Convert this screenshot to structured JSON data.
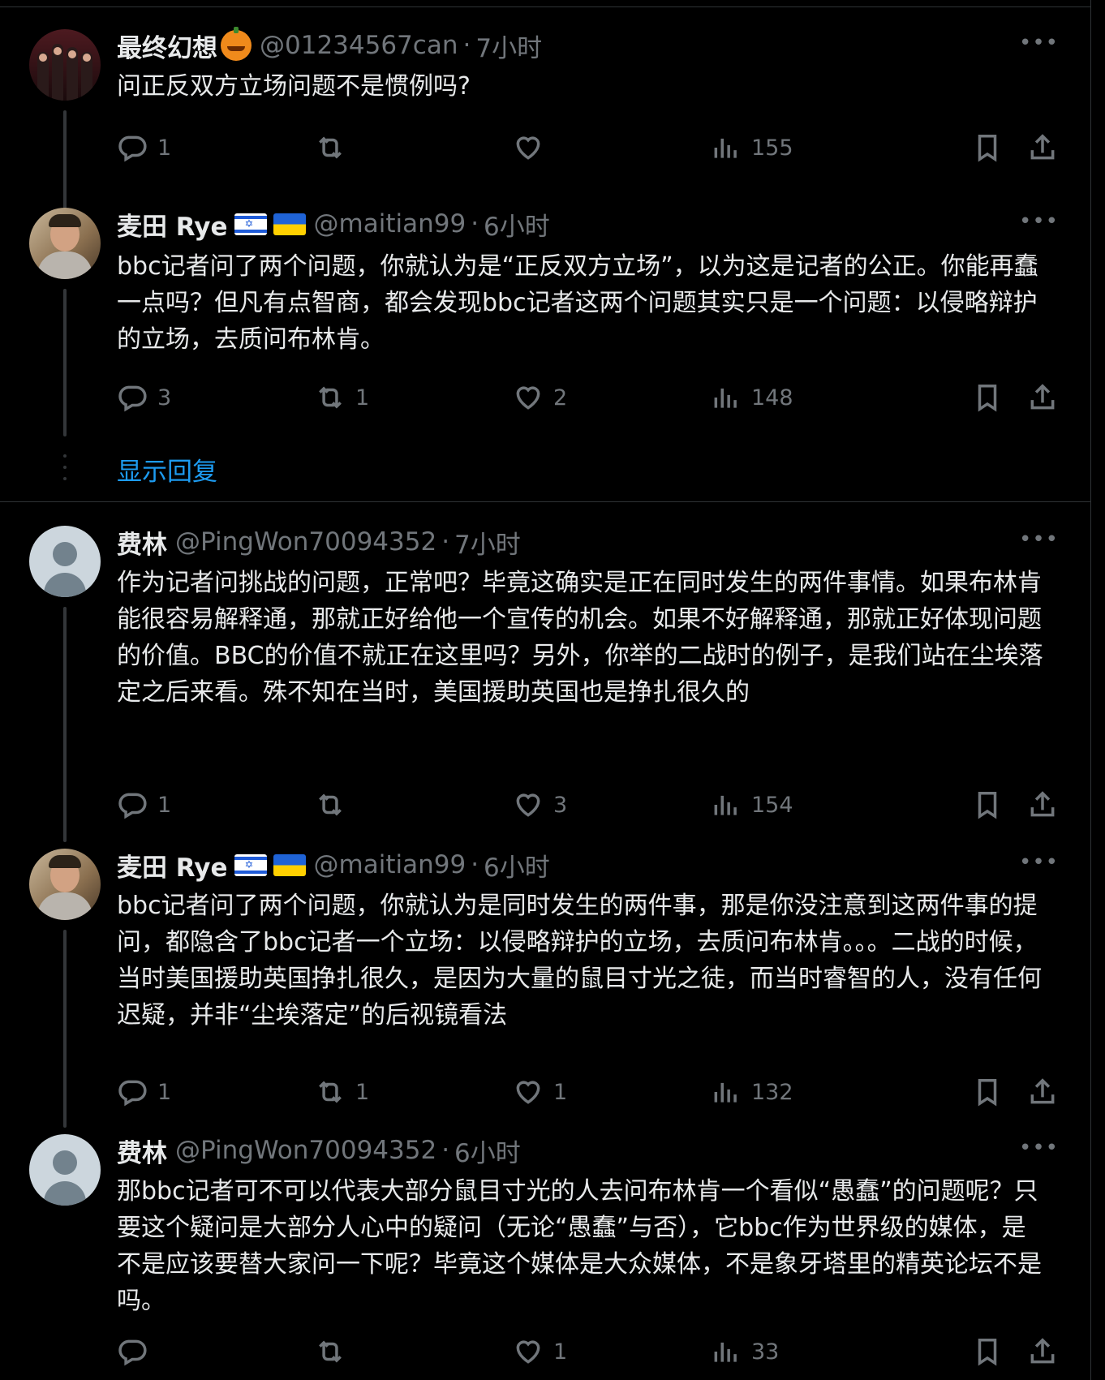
{
  "tweets": [
    {
      "name": "最终幻想",
      "handle": "@01234567can",
      "time": "7小时",
      "text": "问正反双方立场问题不是惯例吗?",
      "replies": "1",
      "retweets": "",
      "likes": "",
      "views": "155"
    },
    {
      "name": "麦田 Rye",
      "handle": "@maitian99",
      "time": "6小时",
      "text": "bbc记者问了两个问题，你就认为是“正反双方立场”，以为这是记者的公正。你能再蠢一点吗？但凡有点智商，都会发现bbc记者这两个问题其实只是一个问题：以侵略辩护的立场，去质问布林肯。",
      "replies": "3",
      "retweets": "1",
      "likes": "2",
      "views": "148"
    },
    {
      "name": "费林",
      "handle": "@PingWon70094352",
      "time": "7小时",
      "text": "作为记者问挑战的问题，正常吧？毕竟这确实是正在同时发生的两件事情。如果布林肯能很容易解释通，那就正好给他一个宣传的机会。如果不好解释通，那就正好体现问题的价值。BBC的价值不就正在这里吗？另外，你举的二战时的例子，是我们站在尘埃落定之后来看。殊不知在当时，美国援助英国也是挣扎很久的",
      "replies": "1",
      "retweets": "",
      "likes": "3",
      "views": "154"
    },
    {
      "name": "麦田 Rye",
      "handle": "@maitian99",
      "time": "6小时",
      "text": "bbc记者问了两个问题，你就认为是同时发生的两件事，那是你没注意到这两件事的提问，都隐含了bbc记者一个立场：以侵略辩护的立场，去质问布林肯。。。二战的时候，当时美国援助英国挣扎很久，是因为大量的鼠目寸光之徒，而当时睿智的人，没有任何迟疑，并非“尘埃落定”的后视镜看法",
      "replies": "1",
      "retweets": "1",
      "likes": "1",
      "views": "132"
    },
    {
      "name": "费林",
      "handle": "@PingWon70094352",
      "time": "6小时",
      "text": "那bbc记者可不可以代表大部分鼠目寸光的人去问布林肯一个看似“愚蠢”的问题呢？只要这个疑问是大部分人心中的疑问（无论“愚蠢”与否），它bbc作为世界级的媒体，是不是应该要替大家问一下呢？毕竟这个媒体是大众媒体，不是象牙塔里的精英论坛不是吗。",
      "replies": "",
      "retweets": "",
      "likes": "1",
      "views": "33"
    }
  ],
  "show_replies": "显示回复",
  "dot": "·"
}
